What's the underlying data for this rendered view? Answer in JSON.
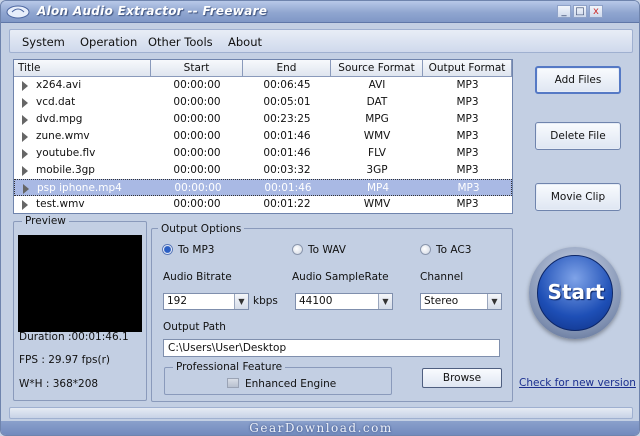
{
  "window": {
    "title": "Alon Audio Extractor -- Freeware",
    "controls": {
      "minimize": "_",
      "maximize": "□",
      "close": "x"
    }
  },
  "menu": [
    "System",
    "Operation",
    "Other Tools",
    "About"
  ],
  "file_list": {
    "columns": [
      "Title",
      "Start",
      "End",
      "Source Format",
      "Output Format"
    ],
    "rows": [
      {
        "title": "x264.avi",
        "start": "00:00:00",
        "end": "00:06:45",
        "source": "AVI",
        "output": "MP3",
        "selected": false
      },
      {
        "title": "vcd.dat",
        "start": "00:00:00",
        "end": "00:05:01",
        "source": "DAT",
        "output": "MP3",
        "selected": false
      },
      {
        "title": "dvd.mpg",
        "start": "00:00:00",
        "end": "00:23:25",
        "source": "MPG",
        "output": "MP3",
        "selected": false
      },
      {
        "title": "zune.wmv",
        "start": "00:00:00",
        "end": "00:01:46",
        "source": "WMV",
        "output": "MP3",
        "selected": false
      },
      {
        "title": "youtube.flv",
        "start": "00:00:00",
        "end": "00:01:46",
        "source": "FLV",
        "output": "MP3",
        "selected": false
      },
      {
        "title": "mobile.3gp",
        "start": "00:00:00",
        "end": "00:03:32",
        "source": "3GP",
        "output": "MP3",
        "selected": false
      },
      {
        "title": "psp iphone.mp4",
        "start": "00:00:00",
        "end": "00:01:46",
        "source": "MP4",
        "output": "MP3",
        "selected": true
      },
      {
        "title": "test.wmv",
        "start": "00:00:00",
        "end": "00:01:22",
        "source": "WMV",
        "output": "MP3",
        "selected": false
      }
    ]
  },
  "buttons": {
    "add_files": "Add Files",
    "delete_file": "Delete File",
    "movie_clip": "Movie Clip",
    "start": "Start",
    "browse": "Browse"
  },
  "preview": {
    "label": "Preview",
    "duration": "Duration :00:01:46.1",
    "fps": "FPS : 29.97 fps(r)",
    "size": "W*H : 368*208"
  },
  "output_options": {
    "label": "Output Options",
    "formats": [
      {
        "label": "To MP3",
        "checked": true
      },
      {
        "label": "To WAV",
        "checked": false
      },
      {
        "label": "To AC3",
        "checked": false
      }
    ],
    "bitrate_label": "Audio Bitrate",
    "bitrate_value": "192",
    "bitrate_unit": "kbps",
    "samplerate_label": "Audio SampleRate",
    "samplerate_value": "44100",
    "channel_label": "Channel",
    "channel_value": "Stereo",
    "path_label": "Output Path",
    "path_value": "C:\\Users\\User\\Desktop",
    "professional_label": "Professional Feature",
    "enhanced_label": "Enhanced Engine"
  },
  "check_update": "Check for new version",
  "watermark": "GearDownload.com",
  "colors": {
    "window_bg": "#c3cfe3",
    "selection": "#a9b9e4",
    "start_button": "#1e4fb6",
    "link": "#1b2f8f"
  }
}
